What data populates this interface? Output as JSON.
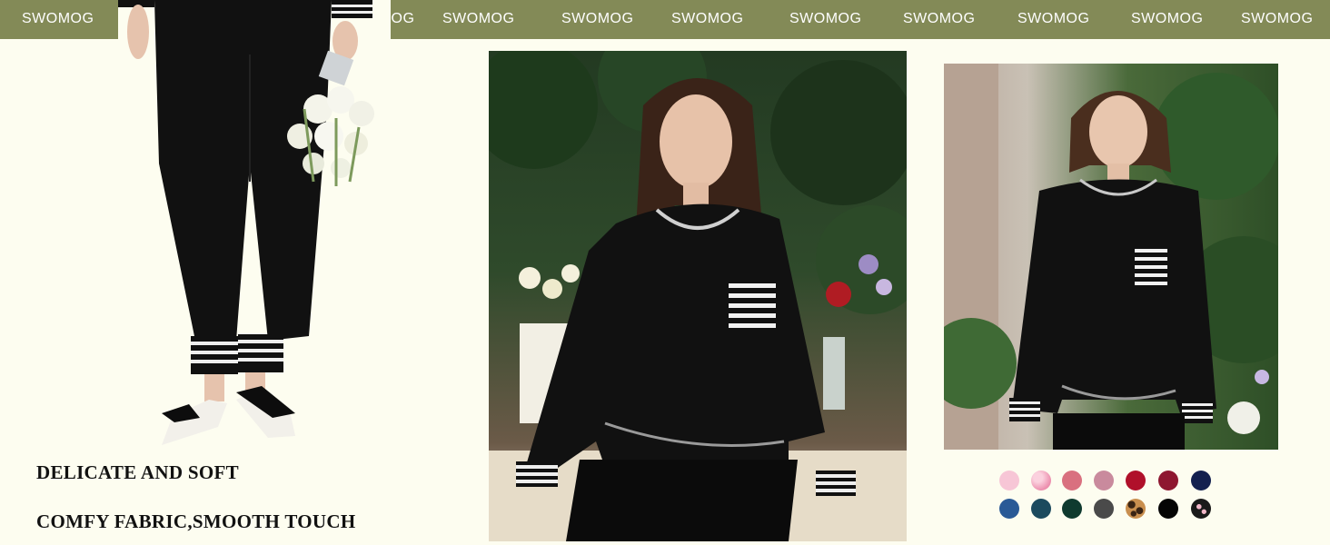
{
  "brand_banner": {
    "items": [
      "SWOMOG",
      "SWOMOG",
      "SWOMOG",
      "SWOMOG",
      "SWOMOG",
      "SWOMOG",
      "SWOMOG",
      "SWOMOG",
      "SWOMOG",
      "SWOMOG"
    ],
    "color": "#838a57"
  },
  "captions": {
    "line1": "DELICATE AND SOFT",
    "line2": "COMFY FABRIC,SMOOTH TOUCH"
  },
  "color_swatches": {
    "row1": [
      "#f7c6d6",
      "#f3a7c0",
      "#d9707f",
      "#c98a9d",
      "#b0102a",
      "#8e1730",
      "#13204f"
    ],
    "row2": [
      "#2a5a96",
      "#1c4a5e",
      "#0f3a2f",
      "#4a4a4a",
      "leopard",
      "#050505",
      "#1a1a1a"
    ]
  }
}
